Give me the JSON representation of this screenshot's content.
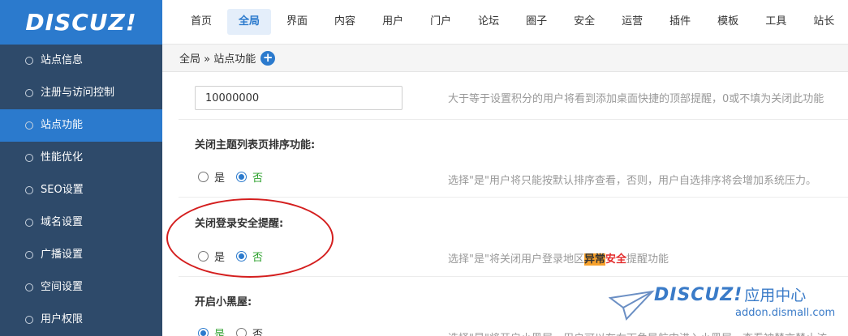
{
  "logo": {
    "text": "DISCUZ!"
  },
  "topnav": {
    "items": [
      "首页",
      "全局",
      "界面",
      "内容",
      "用户",
      "门户",
      "论坛",
      "圈子",
      "安全",
      "运营",
      "插件",
      "模板",
      "工具",
      "站长"
    ],
    "active_index": 1
  },
  "sidebar": {
    "items": [
      "站点信息",
      "注册与访问控制",
      "站点功能",
      "性能优化",
      "SEO设置",
      "域名设置",
      "广播设置",
      "空间设置",
      "用户权限"
    ],
    "active_index": 2
  },
  "breadcrumb": {
    "path": "全局 » 站点功能",
    "add_icon": "plus-circle-icon"
  },
  "content": {
    "points_input": {
      "value": "10000000"
    },
    "points_tip": "大于等于设置积分的用户将看到添加桌面快捷的顶部提醒，0或不填为关闭此功能",
    "sort_setting": {
      "label": "关闭主题列表页排序功能:",
      "options": [
        "是",
        "否"
      ],
      "selected": "否",
      "tip": "选择\"是\"用户将只能按默认排序查看，否则，用户自选排序将会增加系统压力。"
    },
    "login_alert_setting": {
      "label": "关闭登录安全提醒:",
      "options": [
        "是",
        "否"
      ],
      "selected": "否",
      "tip_prefix": "选择\"是\"将关闭用户登录地区",
      "tip_hl1": "异常",
      "tip_hl2": "安全",
      "tip_suffix": "提醒功能"
    },
    "blackroom_setting": {
      "label": "开启小黑屋:",
      "options": [
        "是",
        "否"
      ],
      "selected": "是",
      "tip": "选择\"是\"将开启小黑屋，用户可以在右下角导航中进入小黑屋，查看被禁言禁止访"
    }
  },
  "watermark": {
    "logo": "DISCUZ!",
    "app": "应用中心",
    "url": "addon.dismall.com"
  },
  "colors": {
    "accent": "#2b7acd",
    "sidebar_bg": "#2e4a6a",
    "selected_option": "#2ea22e",
    "annotation": "#d41e1e",
    "highlight": "#f7a12b"
  }
}
